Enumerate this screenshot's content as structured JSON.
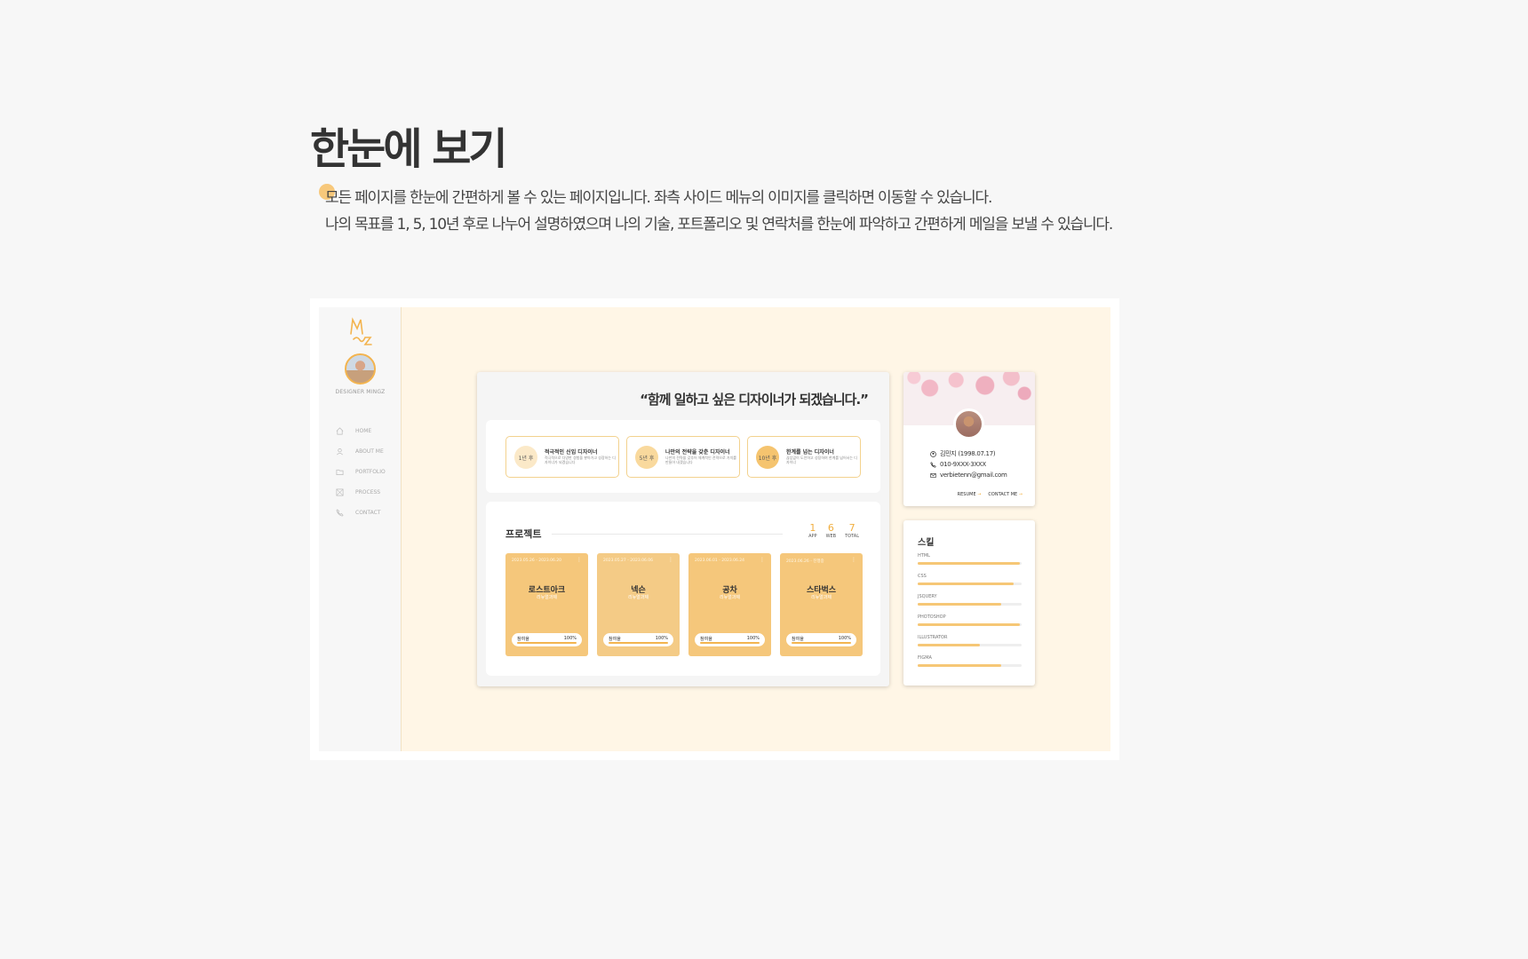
{
  "page": {
    "title": "한눈에 보기",
    "desc_line1": "모든 페이지를 한눈에 간편하게 볼 수 있는 페이지입니다. 좌측 사이드 메뉴의 이미지를 클릭하면 이동할 수 있습니다.",
    "desc_line2": "나의 목표를 1, 5, 10년 후로 나누어 설명하였으며 나의 기술, 포트폴리오 및 연락처를 한눈에 파악하고 간편하게 메일을 보낼 수 있습니다."
  },
  "sidebar": {
    "brand": "DESIGNER MINGZ",
    "items": [
      {
        "label": "HOME",
        "icon": "home-icon"
      },
      {
        "label": "ABOUT ME",
        "icon": "user-icon"
      },
      {
        "label": "PORTFOLIO",
        "icon": "folder-icon"
      },
      {
        "label": "PROCESS",
        "icon": "process-icon"
      },
      {
        "label": "CONTACT",
        "icon": "phone-icon"
      }
    ]
  },
  "main": {
    "quote": "“함께 일하고 싶은 디자이너가 되겠습니다.”",
    "goals": [
      {
        "badge": "1년 후",
        "title": "적극적인 신입 디자이너",
        "sub": "적극적으로 다양한 경험을 쌓아가고 성장하는 디자이너가 되겠습니다",
        "color": "#fbe9c8"
      },
      {
        "badge": "5년 후",
        "title": "나만의 전략을 갖춘 디자이너",
        "sub": "나만의 전략을 갖추어 체계적인 전략으로 가치를 만들어 내겠습니다",
        "color": "#f9d99d"
      },
      {
        "badge": "10년 후",
        "title": "한계를 넘는 디자이너",
        "sub": "끊임없이 도전하고 성장하여 한계를 넘어서는 디자이너",
        "color": "#f5c46f"
      }
    ],
    "projects_title": "프로젝트",
    "counts": [
      {
        "num": "1",
        "label": "APP"
      },
      {
        "num": "6",
        "label": "WEB"
      },
      {
        "num": "7",
        "label": "TOTAL"
      }
    ],
    "projects": [
      {
        "date": "2023.05.26 - 2023.06.20",
        "name": "로스트아크",
        "type": "리뉴얼과제",
        "bar_label": "참여율",
        "pct": "100%"
      },
      {
        "date": "2023.05.27 - 2023.06.06",
        "name": "넥슨",
        "type": "리뉴얼과제",
        "bar_label": "참여율",
        "pct": "100%"
      },
      {
        "date": "2023.06.01 - 2023.06.24",
        "name": "공차",
        "type": "리뉴얼과제",
        "bar_label": "참여율",
        "pct": "100%"
      },
      {
        "date": "2023.06.26 - 진행중",
        "name": "스타벅스",
        "type": "리뉴얼과제",
        "bar_label": "참여율",
        "pct": "100%"
      }
    ]
  },
  "profile": {
    "name": "김민지 (1998.07.17)",
    "phone": "010-9XXX-3XXX",
    "email": "verbietenn@gmail.com",
    "resume": "RESUME",
    "contact": "CONTACT ME"
  },
  "skills": {
    "title": "스킬",
    "items": [
      {
        "name": "HTML",
        "level": 0.98
      },
      {
        "name": "CSS",
        "level": 0.92
      },
      {
        "name": "JSQUERY",
        "level": 0.8
      },
      {
        "name": "PHOTOSHOP",
        "level": 0.98
      },
      {
        "name": "ILLUSTRATOR",
        "level": 0.6
      },
      {
        "name": "FIGMA",
        "level": 0.8
      }
    ]
  },
  "colors": {
    "accent": "#f3b44f",
    "background": "#f7f7f7",
    "app_bg": "#fff6e6"
  }
}
